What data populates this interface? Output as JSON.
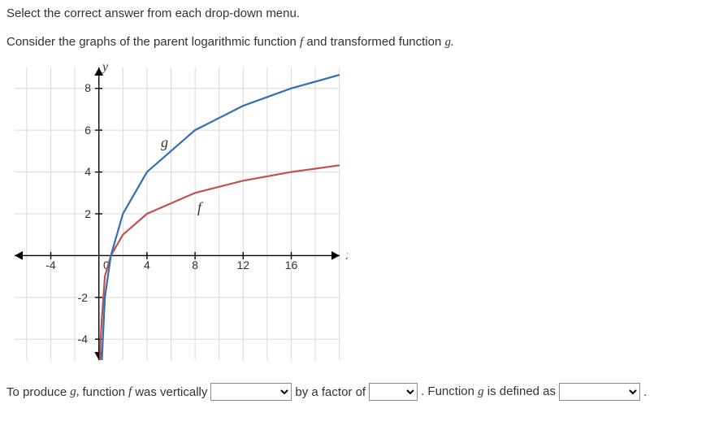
{
  "instruction": "Select the correct answer from each drop-down menu.",
  "prompt_pre": "Consider the graphs of the parent logarithmic function ",
  "prompt_f": "f",
  "prompt_mid": " and transformed function ",
  "prompt_g": "g.",
  "answer": {
    "t1_pre": "To produce ",
    "t1_g": "g,",
    "t1_mid": " function ",
    "t1_f": "f",
    "t1_post": " was vertically",
    "t2": "by a factor of",
    "t3_pre": ". Function ",
    "t3_g": "g",
    "t3_post": " is defined as",
    "period": "."
  },
  "axis": {
    "x": "x",
    "y": "y"
  },
  "labels": {
    "f": "f",
    "g": "g"
  },
  "chart_data": {
    "type": "line",
    "xlabel": "x",
    "ylabel": "y",
    "xlim": [
      -7,
      20
    ],
    "ylim": [
      -5,
      9
    ],
    "x_ticks": [
      -4,
      0,
      4,
      8,
      12,
      16
    ],
    "y_ticks": [
      -4,
      -2,
      2,
      4,
      6,
      8
    ],
    "series": [
      {
        "name": "f",
        "color": "#c1504e",
        "x": [
          0.5,
          1,
          2,
          4,
          8,
          12,
          16,
          20
        ],
        "values": [
          -1,
          0,
          1,
          2,
          3,
          3.585,
          4,
          4.322
        ]
      },
      {
        "name": "g",
        "color": "#2f6fb3",
        "x": [
          0.5,
          1,
          2,
          4,
          8,
          12,
          16,
          20
        ],
        "values": [
          -2,
          0,
          2,
          4,
          6,
          7.17,
          8,
          8.644
        ]
      }
    ],
    "annotations": [
      {
        "text": "f",
        "x": 8,
        "y": 2.5
      },
      {
        "text": "g",
        "x": 5,
        "y": 5.4
      }
    ]
  }
}
